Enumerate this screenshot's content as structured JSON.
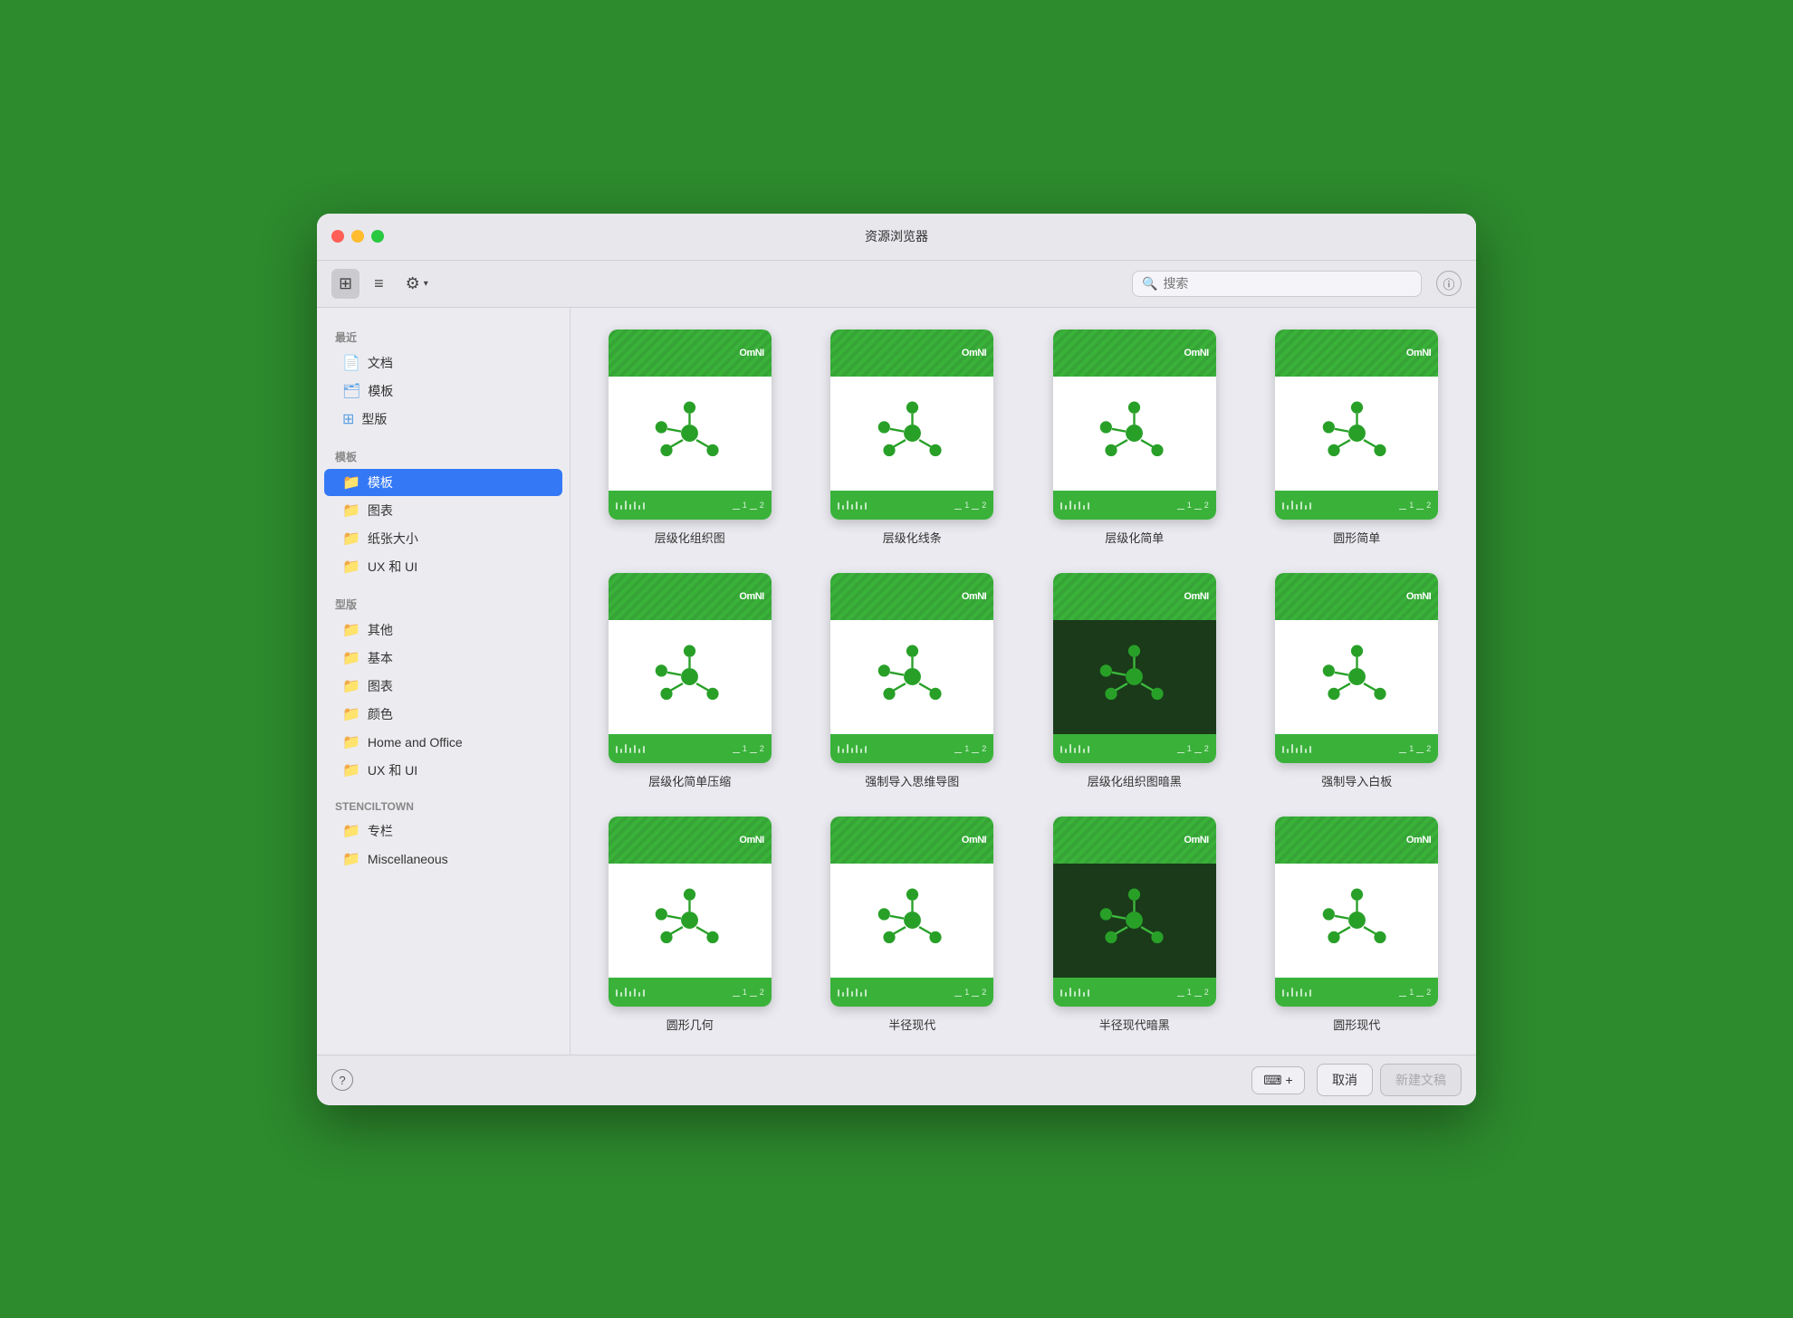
{
  "window": {
    "title": "资源浏览器"
  },
  "toolbar": {
    "grid_view_label": "⊞",
    "list_view_label": "≡",
    "settings_label": "⚙",
    "settings_arrow": "▾",
    "search_placeholder": "搜索",
    "info_label": "ⓘ"
  },
  "sidebar": {
    "sections": [
      {
        "label": "最近",
        "items": [
          {
            "name": "文档",
            "icon": "doc",
            "active": false
          },
          {
            "name": "模板",
            "icon": "template",
            "active": false
          },
          {
            "name": "型版",
            "icon": "stencil",
            "active": false
          }
        ]
      },
      {
        "label": "模板",
        "items": [
          {
            "name": "图表",
            "icon": "folder",
            "active": false
          },
          {
            "name": "纸张大小",
            "icon": "folder",
            "active": false
          },
          {
            "name": "UX 和 UI",
            "icon": "folder",
            "active": false
          }
        ],
        "selected_label": "模板"
      },
      {
        "label": "型版",
        "items": [
          {
            "name": "其他",
            "icon": "folder",
            "active": false
          },
          {
            "name": "基本",
            "icon": "folder",
            "active": false
          },
          {
            "name": "图表",
            "icon": "folder",
            "active": false
          },
          {
            "name": "颜色",
            "icon": "folder",
            "active": false
          },
          {
            "name": "Home and Office",
            "icon": "folder",
            "active": false
          },
          {
            "name": "UX 和 UI",
            "icon": "folder",
            "active": false
          }
        ]
      },
      {
        "label": "STENCILTOWN",
        "items": [
          {
            "name": "专栏",
            "icon": "folder",
            "active": false
          },
          {
            "name": "Miscellaneous",
            "icon": "folder",
            "active": false
          }
        ]
      }
    ]
  },
  "templates": [
    {
      "name": "层级化组织图",
      "dark": false
    },
    {
      "name": "层级化线条",
      "dark": false
    },
    {
      "name": "层级化简单",
      "dark": false
    },
    {
      "name": "圆形简单",
      "dark": false
    },
    {
      "name": "层级化简单压缩",
      "dark": false
    },
    {
      "name": "强制导入思维导图",
      "dark": false
    },
    {
      "name": "层级化组织图暗黑",
      "dark": true
    },
    {
      "name": "强制导入白板",
      "dark": false
    },
    {
      "name": "圆形几何",
      "dark": false
    },
    {
      "name": "半径现代",
      "dark": false
    },
    {
      "name": "半径现代暗黑",
      "dark": true
    },
    {
      "name": "圆形现代",
      "dark": false
    }
  ],
  "bottom_bar": {
    "help_label": "?",
    "add_label": "⌨+",
    "cancel_label": "取消",
    "new_doc_label": "新建文稿"
  }
}
